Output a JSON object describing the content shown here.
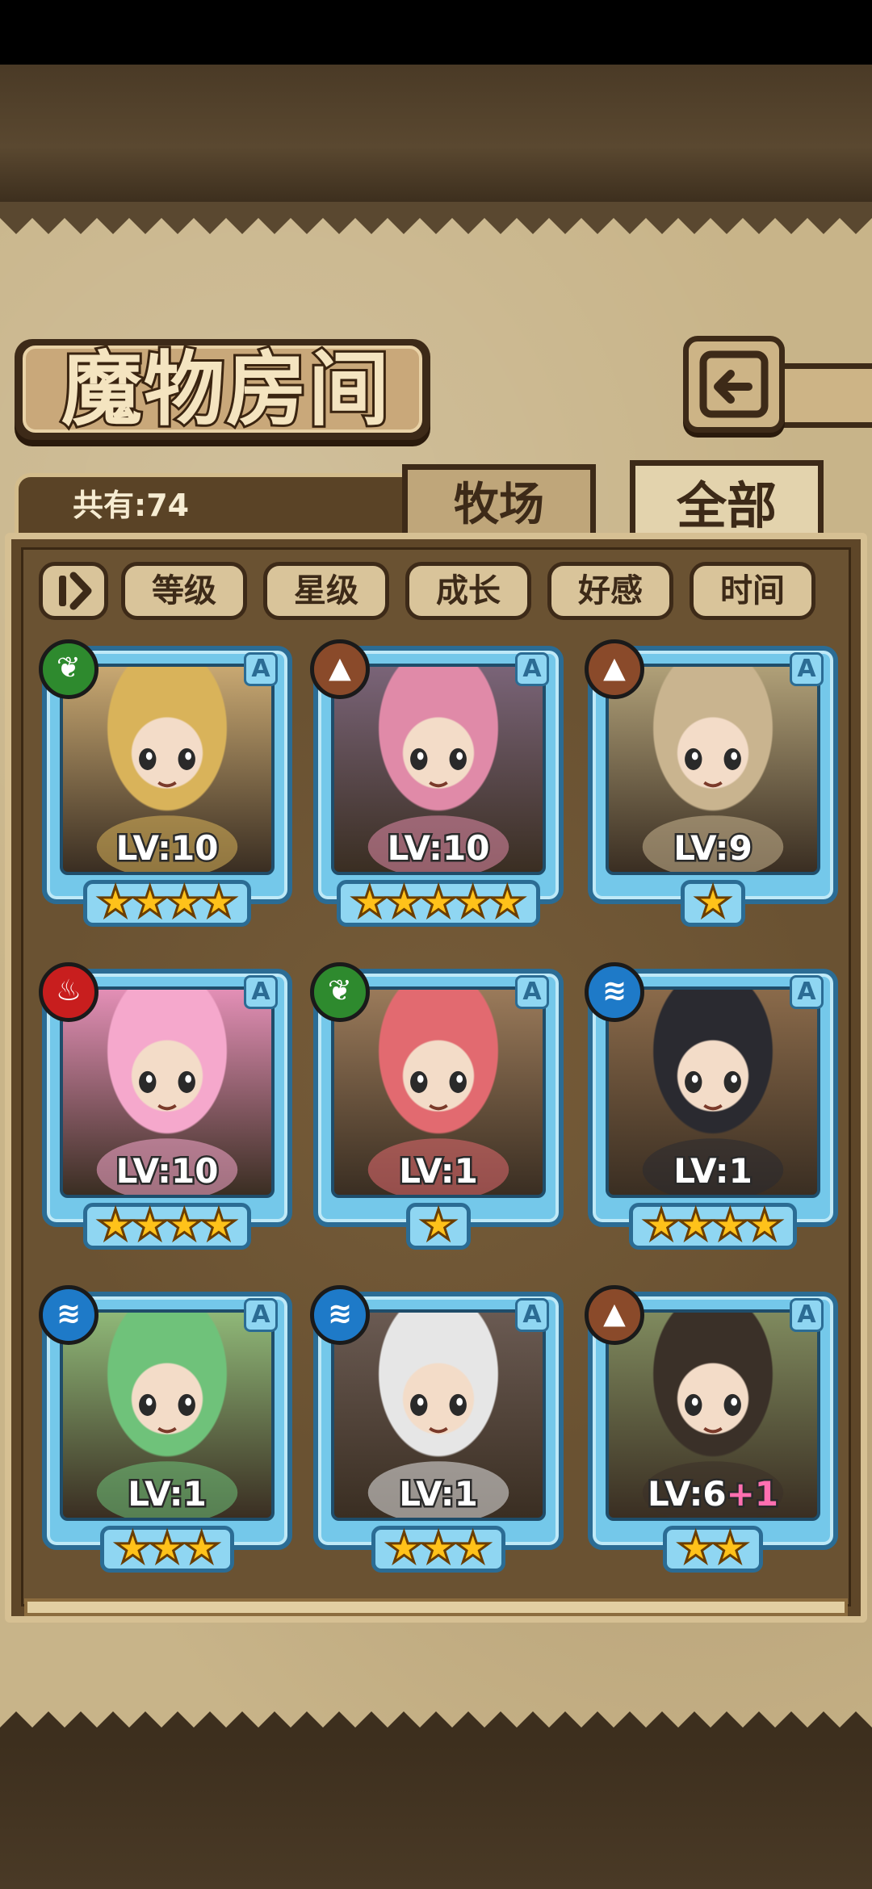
{
  "header": {
    "title": "魔物房间",
    "back_icon": "back-arrow-icon"
  },
  "summary": {
    "count_label": "共有:74"
  },
  "tabs": [
    {
      "label": "牧场",
      "active": false
    },
    {
      "label": "全部",
      "active": true
    }
  ],
  "filters": {
    "toggle_icon": "sort-toggle-icon",
    "buttons": [
      "等级",
      "星级",
      "成长",
      "好感",
      "时间"
    ]
  },
  "elements": {
    "nature": {
      "color": "#2e8a2e",
      "glyph": "❦"
    },
    "earth": {
      "color": "#8a4a2a",
      "glyph": "▲"
    },
    "fire": {
      "color": "#c81e1e",
      "glyph": "♨"
    },
    "water": {
      "color": "#1e7ac8",
      "glyph": "≋"
    }
  },
  "cards": [
    {
      "level": "LV:10",
      "plus": "",
      "stars": "★★★★",
      "star_count": 4,
      "rank": "A",
      "element": "nature",
      "color": "#c8a872",
      "hair": "#d9b35a"
    },
    {
      "level": "LV:10",
      "plus": "",
      "stars": "★★★★★",
      "star_count": 5,
      "rank": "A",
      "element": "earth",
      "color": "#7a6478",
      "hair": "#e08aa8"
    },
    {
      "level": "LV:9",
      "plus": "",
      "stars": "★",
      "star_count": 1,
      "rank": "A",
      "element": "earth",
      "color": "#b0a078",
      "hair": "#c9b48f"
    },
    {
      "level": "LV:10",
      "plus": "",
      "stars": "★★★★",
      "star_count": 4,
      "rank": "A",
      "element": "fire",
      "color": "#e38fb6",
      "hair": "#f5a8cc"
    },
    {
      "level": "LV:1",
      "plus": "",
      "stars": "★",
      "star_count": 1,
      "rank": "A",
      "element": "nature",
      "color": "#9a7a5a",
      "hair": "#e26a70"
    },
    {
      "level": "LV:1",
      "plus": "",
      "stars": "★★★★",
      "star_count": 4,
      "rank": "A",
      "element": "water",
      "color": "#8a6a4a",
      "hair": "#2a2a30"
    },
    {
      "level": "LV:1",
      "plus": "",
      "stars": "★★★",
      "star_count": 3,
      "rank": "A",
      "element": "water",
      "color": "#8fb878",
      "hair": "#6fc27a"
    },
    {
      "level": "LV:1",
      "plus": "",
      "stars": "★★★",
      "star_count": 3,
      "rank": "A",
      "element": "water",
      "color": "#6a5a52",
      "hair": "#e6e6e6"
    },
    {
      "level": "LV:6",
      "plus": "+1",
      "stars": "★★",
      "star_count": 2,
      "rank": "A",
      "element": "earth",
      "color": "#7f8a5e",
      "hair": "#3a3028"
    }
  ]
}
